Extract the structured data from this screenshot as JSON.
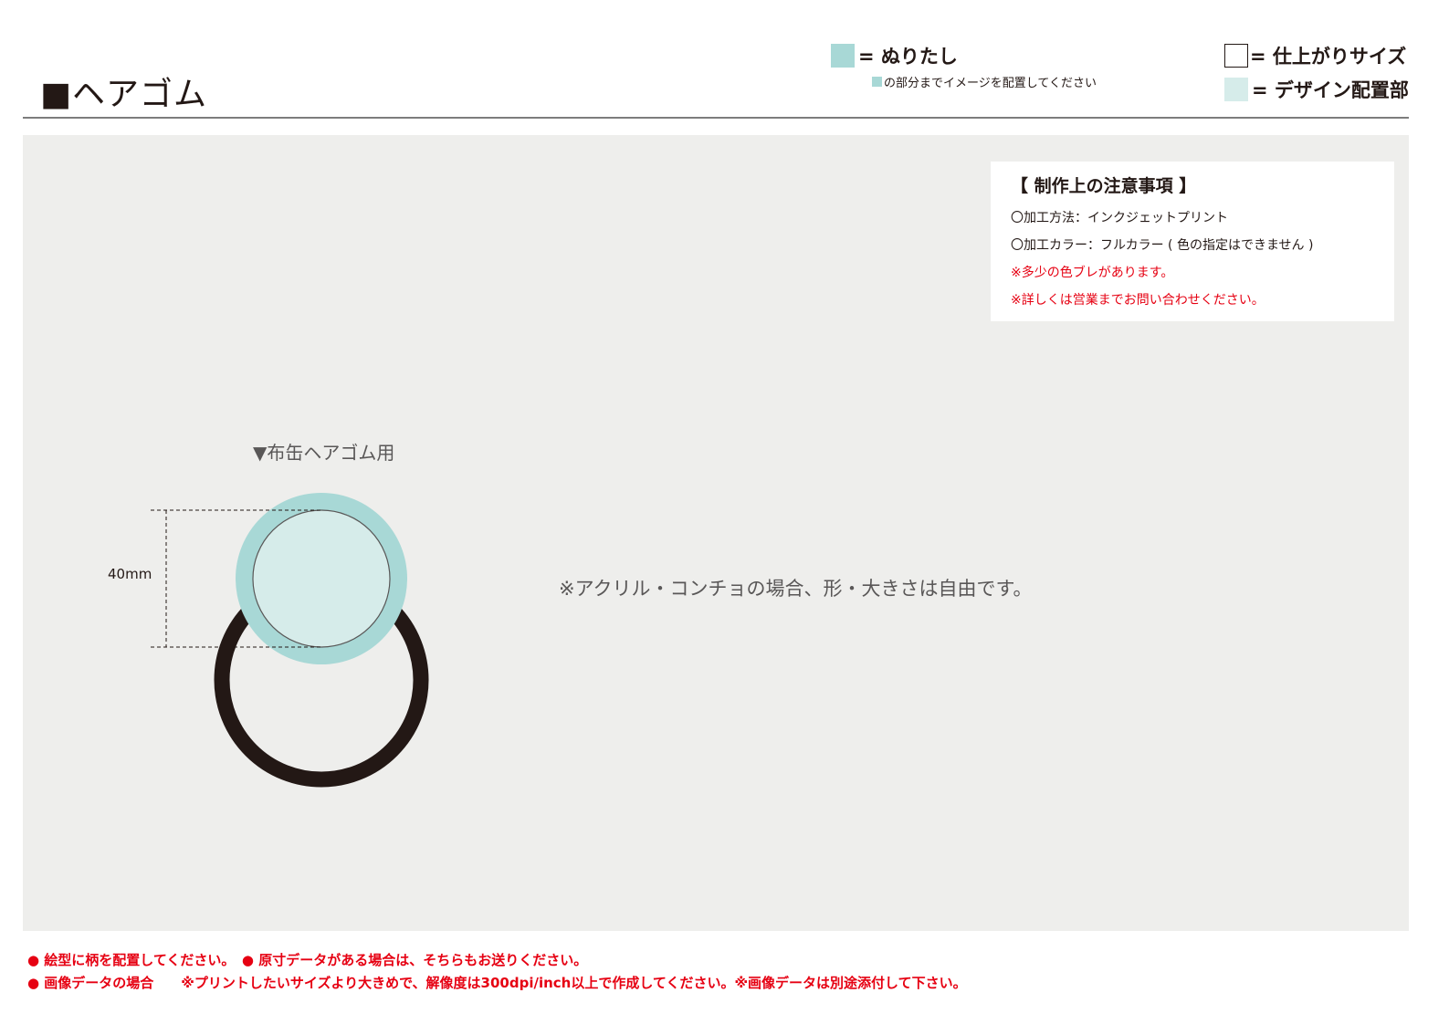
{
  "header": {
    "title": "■ヘアゴム"
  },
  "legend": {
    "bleed_label": "= ぬりたし",
    "bleed_note": "の部分までイメージを配置してください",
    "finish_label": "= 仕上がりサイズ",
    "design_label": "= デザイン配置部",
    "colors": {
      "bleed": "#a8d8d6",
      "design_area": "#d6ecea",
      "finish_outline": "#231815"
    }
  },
  "notes": {
    "title": "【 制作上の注意事項 】",
    "lines": [
      "〇加工方法：インクジェットプリント",
      "〇加工カラー：フルカラー ( 色の指定はできません )",
      "※多少の色ブレがあります。",
      "※詳しくは営業までお問い合わせください。"
    ],
    "warning_color": "#e60012"
  },
  "diagram": {
    "label": "▼布缶ヘアゴム用",
    "dimension": "40mm",
    "free_shape_note": "※アクリル・コンチョの場合、形・大きさは自由です。",
    "canvas_color": "#eeeeec",
    "band_color": "#231815"
  },
  "footer": {
    "line1": "● 絵型に柄を配置してください。　● 原寸データがある場合は、そちらもお送りください。",
    "line2": "● 画像データの場合　　※プリントしたいサイズより大きめで、解像度は300dpi/inch以上で作成してください。※画像データは別途添付して下さい。"
  }
}
